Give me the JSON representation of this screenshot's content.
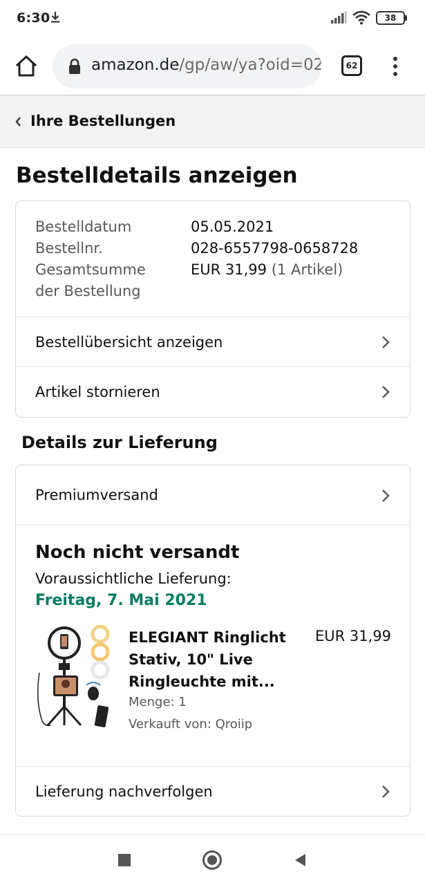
{
  "status_bar": {
    "time": "6:30",
    "battery": "38"
  },
  "browser": {
    "url_host": "amazon.de",
    "url_path": "/gp/aw/ya?oid=02",
    "tab_count": "62"
  },
  "breadcrumb": {
    "label": "Ihre Bestellungen"
  },
  "page_title": "Bestelldetails anzeigen",
  "order_info": {
    "date_label": "Bestelldatum",
    "date_value": "05.05.2021",
    "number_label": "Bestellnr.",
    "number_value": "028-6557798-0658728",
    "total_label_line1": "Gesamtsumme",
    "total_label_line2": "der Bestellung",
    "total_value": "EUR 31,99",
    "total_count": "(1 Artikel)"
  },
  "order_actions": {
    "summary": "Bestellübersicht anzeigen",
    "cancel": "Artikel stornieren"
  },
  "delivery_section": {
    "title": "Details zur Lieferung",
    "shipping_speed": "Premiumversand",
    "status": "Noch nicht versandt",
    "expected_label": "Voraussichtliche Lieferung:",
    "expected_date": "Freitag, 7. Mai 2021",
    "expected_date_color": "#067d62",
    "track": "Lieferung nachverfolgen"
  },
  "product": {
    "title": "ELEGIANT Ringlicht Stativ, 10\" Live Ringleuchte mit...",
    "price": "EUR 31,99",
    "quantity": "Menge: 1",
    "seller": "Verkauft von: Qroiip"
  }
}
